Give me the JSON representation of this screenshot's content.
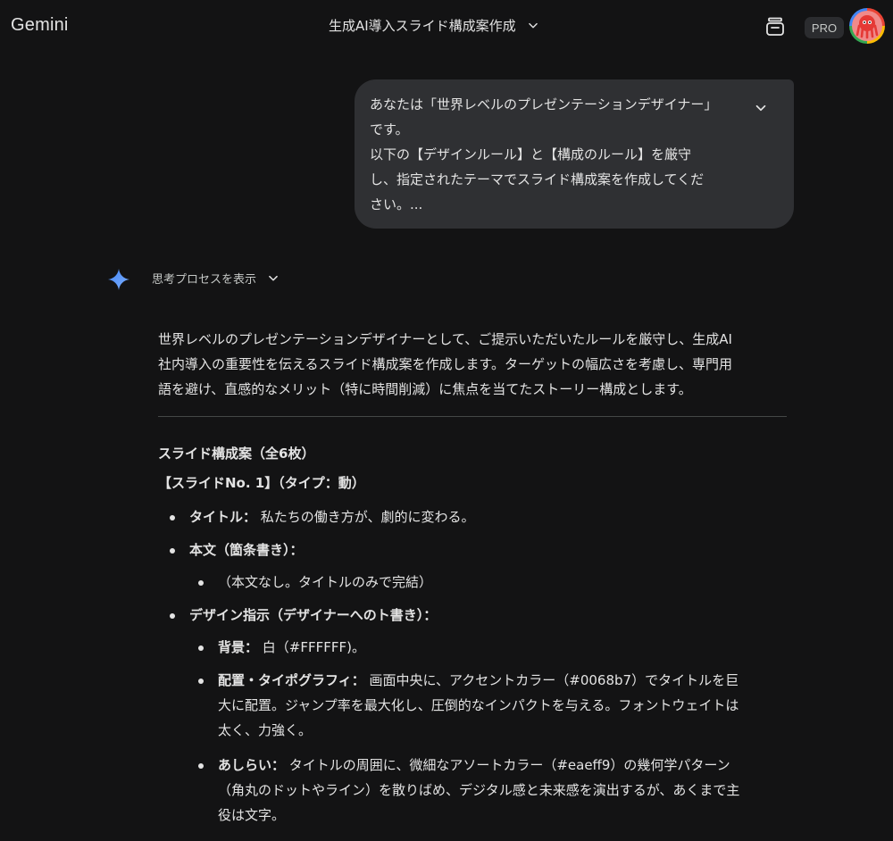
{
  "header": {
    "app_name": "Gemini",
    "chat_title": "生成AI導入スライド構成案作成",
    "pro_badge": "PRO"
  },
  "user_message": {
    "lines": [
      "あなたは「世界レベルのプレゼンテーションデザイナー」",
      "です。",
      "以下の【デザインルール】と【構成のルール】を厳守",
      "し、指定されたテーマでスライド構成案を作成してくだ",
      "さい。..."
    ]
  },
  "thinking": {
    "label": "思考プロセスを表示"
  },
  "response": {
    "intro_lines": [
      "世界レベルのプレゼンテーションデザイナーとして、ご提示いただいたルールを厳守し、生成AI",
      "社内導入の重要性を伝えるスライド構成案を作成します。ターゲットの幅広さを考慮し、専門用",
      "語を避け、直感的なメリット（特に時間削減）に焦点を当てたストーリー構成とします。"
    ],
    "heading": "スライド構成案（全6枚）",
    "slide_heading": "【スライドNo. 1】（タイプ：動）",
    "items": {
      "title_label": "タイトル：",
      "title_value": " 私たちの働き方が、劇的に変わる。",
      "body_label": "本文（箇条書き）：",
      "body_sub": "（本文なし。タイトルのみで完結）",
      "design_label": "デザイン指示（デザイナーへのト書き）：",
      "bg_label": "背景：",
      "bg_value": " 白（#FFFFFF)。",
      "layout_label": "配置・タイポグラフィ：",
      "layout_lines": [
        " 画面中央に、アクセントカラー（#0068b7）でタイトルを巨",
        "大に配置。ジャンプ率を最大化し、圧倒的なインパクトを与える。フォントウェイトは",
        "太く、力強く。"
      ],
      "deco_label": "あしらい：",
      "deco_lines": [
        " タイトルの周囲に、微細なアソートカラー（#eaeff9）の幾何学パターン",
        "（角丸のドットやライン）を散りばめ、デジタル感と未来感を演出するが、あくまで主",
        "役は文字。"
      ]
    }
  },
  "colors": {
    "background": "#131314",
    "bubble": "#2f3033",
    "text": "#e3e3e3",
    "muted": "#c4c7c5",
    "divider": "#444746",
    "sparkle": "#4285f4"
  },
  "icons": [
    "chevron-down-icon",
    "share-icon",
    "sparkle-icon",
    "avatar-octopus-icon"
  ]
}
